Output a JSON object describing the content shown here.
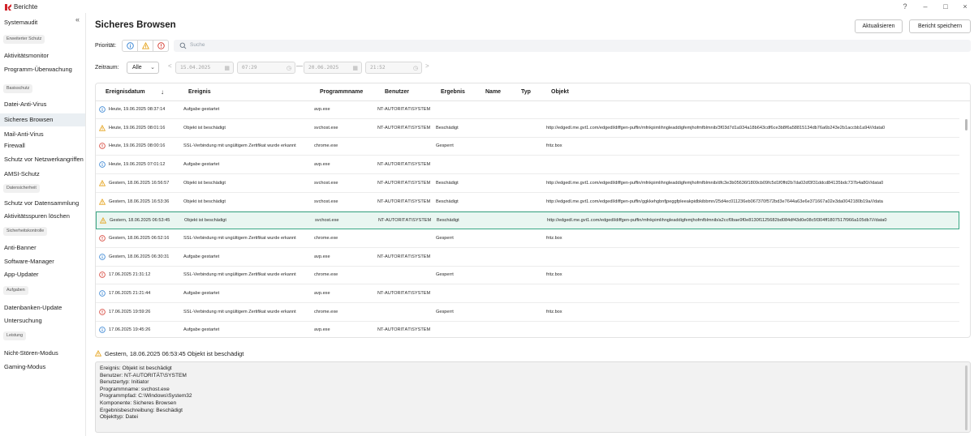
{
  "app": {
    "title": "Berichte",
    "window_controls": [
      "?",
      "–",
      "□",
      "×"
    ],
    "collapse_glyph": "«"
  },
  "sidebar": {
    "items": [
      {
        "label": "Systemaudit"
      },
      {
        "group": "Erweiterter Schutz"
      },
      {
        "label": "Aktivitätsmonitor"
      },
      {
        "label": "Programm-Überwachung"
      },
      {
        "group": "Basisschutz"
      },
      {
        "label": "Datei-Anti-Virus"
      },
      {
        "label": "Sicheres Browsen",
        "active": true
      },
      {
        "label": "Mail-Anti-Virus"
      },
      {
        "label": "Firewall"
      },
      {
        "label": "Schutz vor Netzwerkangriffen"
      },
      {
        "label": "AMSI-Schutz"
      },
      {
        "group": "Datensicherheit"
      },
      {
        "label": "Schutz vor Datensammlung"
      },
      {
        "label": "Aktivitätsspuren löschen"
      },
      {
        "group": "Sicherheitskontrolle"
      },
      {
        "label": "Anti-Banner"
      },
      {
        "label": "Software-Manager"
      },
      {
        "label": "App-Updater"
      },
      {
        "group": "Aufgaben"
      },
      {
        "label": "Datenbanken-Update"
      },
      {
        "label": "Untersuchung"
      },
      {
        "group": "Leistung"
      },
      {
        "label": "Nicht-Stören-Modus"
      },
      {
        "label": "Gaming-Modus"
      }
    ]
  },
  "header": {
    "title": "Sicheres Browsen",
    "refresh_label": "Aktualisieren",
    "save_label": "Bericht speichern"
  },
  "filters": {
    "priority_label": "Priorität:",
    "search_placeholder": "Suche",
    "period_label": "Zeitraum:",
    "period_value": "Alle",
    "date_from": "15.04.2025",
    "time_from": "07:29",
    "date_to": "20.06.2025",
    "time_to": "21:52",
    "prev_glyph": "<",
    "next_glyph": ">",
    "range_dash": "—"
  },
  "table": {
    "columns": [
      "Ereignisdatum",
      "Ereignis",
      "Programmname",
      "Benutzer",
      "Ergebnis",
      "Name",
      "Typ",
      "Objekt"
    ],
    "sort_glyph": "↓",
    "rows": [
      {
        "severity": "info",
        "date": "Heute, 19.06.2025 08:37:14",
        "event": "Aufgabe gestartet",
        "program": "avp.exe",
        "user": "NT-AUTORITÄT\\SYSTEM",
        "result": "",
        "object": ""
      },
      {
        "severity": "warning",
        "date": "Heute, 19.06.2025 08:01:16",
        "event": "Objekt ist beschädigt",
        "program": "svchost.exe",
        "user": "NT-AUTORITÄT\\SYSTEM",
        "result": "Beschädigt",
        "object": "http://edgedl.me.gvt1.com/edgedl/diffgen-puffin/mfnkpimlihngleaddigfemjhofmfblmnib/3f03d7d1a934a18b643cdf6ce3b8f6a58815134db76a6b243e2b1accbb1a94///data0"
      },
      {
        "severity": "error",
        "date": "Heute, 19.06.2025 08:00:16",
        "event": "SSL-Verbindung mit ungültigem Zertifikat wurde erkannt",
        "program": "chrome.exe",
        "user": "",
        "result": "Gesperrt",
        "object": "fritz.box"
      },
      {
        "severity": "info",
        "date": "Heute, 19.06.2025 07:01:12",
        "event": "Aufgabe gestartet",
        "program": "avp.exe",
        "user": "NT-AUTORITÄT\\SYSTEM",
        "result": "",
        "object": ""
      },
      {
        "severity": "warning",
        "date": "Gestern, 18.06.2025 16:56:57",
        "event": "Objekt ist beschädigt",
        "program": "svchost.exe",
        "user": "NT-AUTORITÄT\\SYSTEM",
        "result": "Beschädigt",
        "object": "http://edgedl.me.gvt1.com/edgedl/diffgen-puffin/mfnkpimlihngleaddigfemjhofmfblmnib/dfc3e3b05636f1809cb09fc5d1f0ffd2b7da02df3f31ddcd84135bdc737b4a80///data0"
      },
      {
        "severity": "warning",
        "date": "Gestern, 18.06.2025 16:53:36",
        "event": "Objekt ist beschädigt",
        "program": "svchost.exe",
        "user": "NT-AUTORITÄT\\SYSTEM",
        "result": "Beschädigt",
        "object": "http://edgedl.me.gvt1.com/edgedl/diffgen-puffin/ggkkehgbnfjpeggfpleeakpidbkibbmn/25d4ec011236eb067370f572bd3e7644a63e6e371667a02e3da0042180b19a///data"
      },
      {
        "severity": "warning",
        "date": "Gestern, 18.06.2025 06:53:45",
        "event": "Objekt ist beschädigt",
        "program": "svchost.exe",
        "user": "NT-AUTORITÄT\\SYSTEM",
        "result": "Beschädigt",
        "object": "http://edgedl.me.gvt1.com/edgedl/diffgen-puffin/mfnkpimlihngleaddigfemjhofmfblmnib/a2ccf0bae9f0e8130f1125682bd084df43d0e08c5f304ff1807517f966a105db7///data0",
        "selected": true
      },
      {
        "severity": "error",
        "date": "Gestern, 18.06.2025 06:52:16",
        "event": "SSL-Verbindung mit ungültigem Zertifikat wurde erkannt",
        "program": "chrome.exe",
        "user": "",
        "result": "Gesperrt",
        "object": "fritz.box"
      },
      {
        "severity": "info",
        "date": "Gestern, 18.06.2025 06:30:31",
        "event": "Aufgabe gestartet",
        "program": "avp.exe",
        "user": "NT-AUTORITÄT\\SYSTEM",
        "result": "",
        "object": ""
      },
      {
        "severity": "error",
        "date": "17.06.2025 21:31:12",
        "event": "SSL-Verbindung mit ungültigem Zertifikat wurde erkannt",
        "program": "chrome.exe",
        "user": "",
        "result": "Gesperrt",
        "object": "fritz.box"
      },
      {
        "severity": "info",
        "date": "17.06.2025 21:21:44",
        "event": "Aufgabe gestartet",
        "program": "avp.exe",
        "user": "NT-AUTORITÄT\\SYSTEM",
        "result": "",
        "object": ""
      },
      {
        "severity": "error",
        "date": "17.06.2025 19:59:26",
        "event": "SSL-Verbindung mit ungültigem Zertifikat wurde erkannt",
        "program": "chrome.exe",
        "user": "",
        "result": "Gesperrt",
        "object": "fritz.box"
      },
      {
        "severity": "info",
        "date": "17.06.2025 19:45:26",
        "event": "Aufgabe gestartet",
        "program": "avp.exe",
        "user": "NT-AUTORITÄT\\SYSTEM",
        "result": "",
        "object": ""
      }
    ]
  },
  "detail": {
    "severity": "warning",
    "title": "Gestern, 18.06.2025 06:53:45 Objekt ist beschädigt",
    "lines": [
      "Ereignis: Objekt ist beschädigt",
      "Benutzer: NT-AUTORITÄT\\SYSTEM",
      "Benutzertyp: Initiator",
      "Programmname: svchost.exe",
      "Programmpfad: C:\\Windows\\System32",
      "Komponente: Sicheres Browsen",
      "Ergebnisbeschreibung: Beschädigt",
      "Objekttyp: Datei"
    ]
  },
  "colors": {
    "info": "#2f7fd1",
    "warning": "#e5a21a",
    "error": "#d43a2f",
    "selected_border": "#3aa885",
    "selected_bg": "#e9f6f1",
    "active_nav": "#eaeff3"
  }
}
